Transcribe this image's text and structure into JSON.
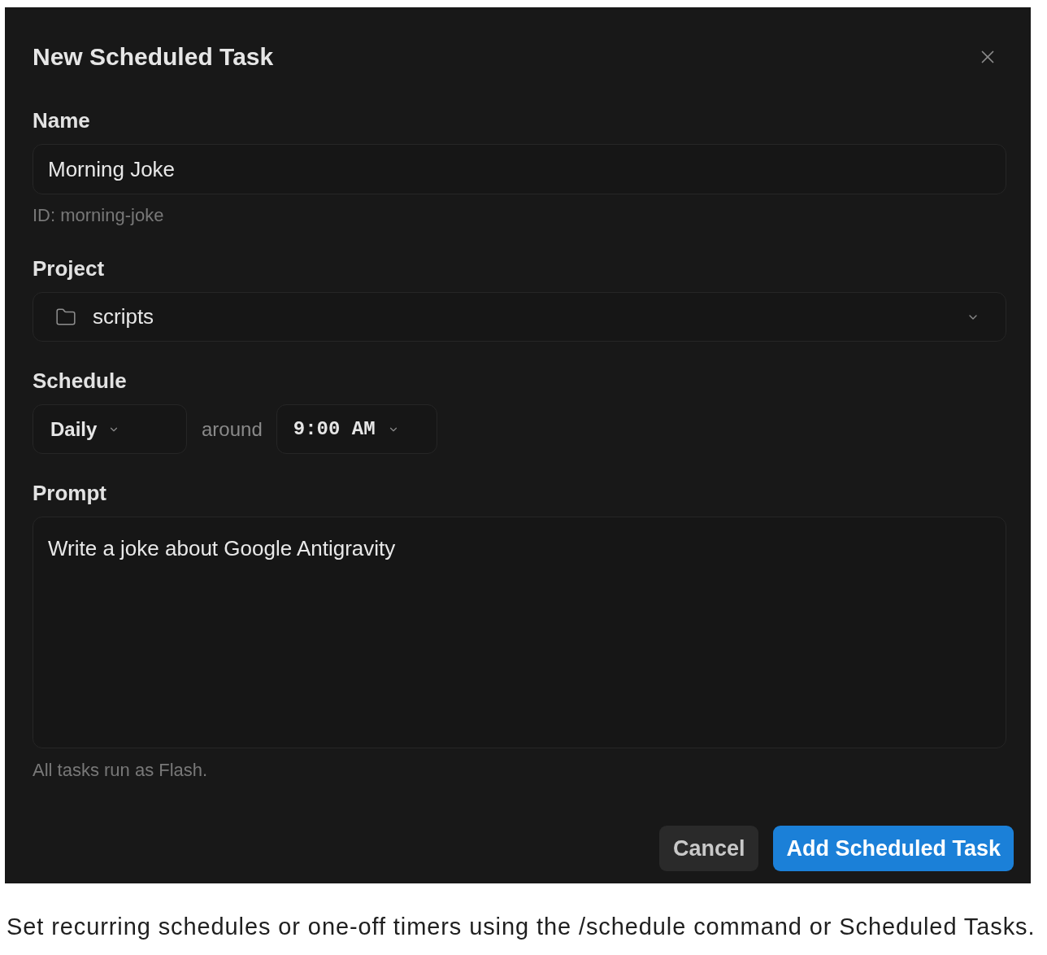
{
  "dialog": {
    "title": "New Scheduled Task"
  },
  "name": {
    "label": "Name",
    "value": "Morning Joke",
    "hint": "ID: morning-joke"
  },
  "project": {
    "label": "Project",
    "value": "scripts"
  },
  "schedule": {
    "label": "Schedule",
    "frequency": "Daily",
    "connector": "around",
    "time": "9:00 AM"
  },
  "prompt": {
    "label": "Prompt",
    "value": "Write a joke about Google Antigravity",
    "note": "All tasks run as Flash."
  },
  "buttons": [
    {
      "label": "Cancel",
      "kind": "secondary"
    },
    {
      "label": "Add Scheduled Task",
      "kind": "primary"
    }
  ],
  "caption": "Set recurring schedules or one-off timers using the /schedule command or Scheduled Tasks."
}
